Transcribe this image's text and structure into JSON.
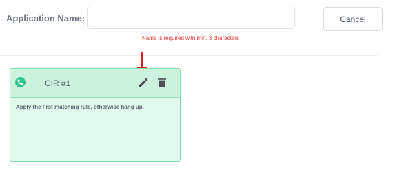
{
  "form": {
    "app_name_label": "Application Name:",
    "app_name_value": "",
    "app_name_placeholder": "",
    "error": "Name is required with min. 3 characters",
    "cancel_label": "Cancel"
  },
  "card": {
    "title": "CIR #1",
    "description": "Apply the first matching rule, otherwise hang up.",
    "icons": [
      "phone-icon",
      "edit-icon",
      "trash-icon"
    ]
  },
  "colors": {
    "error": "#e53935",
    "card_bg": "#e0fbee",
    "card_header": "#ccf2de",
    "card_border": "#86dcb3",
    "icon_green": "#34c48b",
    "arrow": "#e02020"
  }
}
